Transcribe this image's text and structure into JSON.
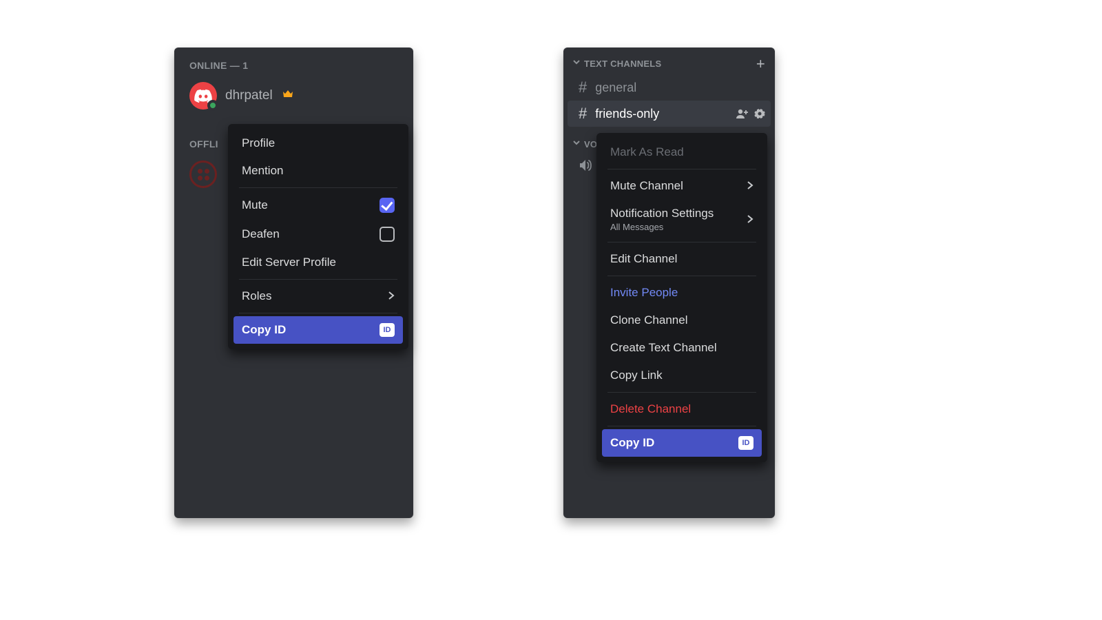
{
  "left": {
    "online_header": "ONLINE — 1",
    "user_name": "dhrpatel",
    "offline_header": "OFFLI",
    "menu": {
      "profile": "Profile",
      "mention": "Mention",
      "mute": "Mute",
      "deafen": "Deafen",
      "edit_server_profile": "Edit Server Profile",
      "roles": "Roles",
      "copy_id": "Copy ID",
      "id_badge": "ID"
    }
  },
  "right": {
    "text_channels_header": "TEXT CHANNELS",
    "channel_general": "general",
    "channel_friends_only": "friends-only",
    "voice_header_truncated": "VOI",
    "menu": {
      "mark_as_read": "Mark As Read",
      "mute_channel": "Mute Channel",
      "notification_settings": "Notification Settings",
      "notification_sub": "All Messages",
      "edit_channel": "Edit Channel",
      "invite_people": "Invite People",
      "clone_channel": "Clone Channel",
      "create_text_channel": "Create Text Channel",
      "copy_link": "Copy Link",
      "delete_channel": "Delete Channel",
      "copy_id": "Copy ID",
      "id_badge": "ID"
    }
  }
}
